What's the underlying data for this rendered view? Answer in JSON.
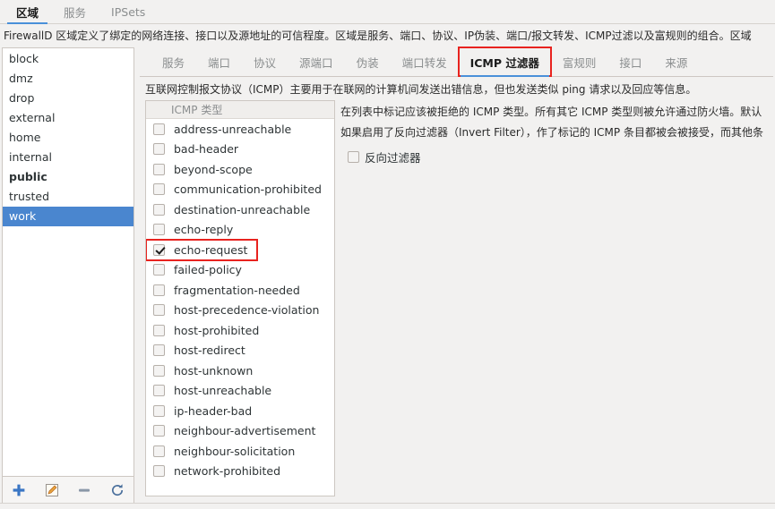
{
  "top_tabs": [
    {
      "label": "区域",
      "active": true
    },
    {
      "label": "服务",
      "active": false
    },
    {
      "label": "IPSets",
      "active": false
    }
  ],
  "zone_description": "FirewallD 区域定义了绑定的网络连接、接口以及源地址的可信程度。区域是服务、端口、协议、IP伪装、端口/报文转发、ICMP过滤以及富规则的组合。区域",
  "zones": [
    {
      "name": "block",
      "default": false,
      "selected": false
    },
    {
      "name": "dmz",
      "default": false,
      "selected": false
    },
    {
      "name": "drop",
      "default": false,
      "selected": false
    },
    {
      "name": "external",
      "default": false,
      "selected": false
    },
    {
      "name": "home",
      "default": false,
      "selected": false
    },
    {
      "name": "internal",
      "default": false,
      "selected": false
    },
    {
      "name": "public",
      "default": true,
      "selected": false
    },
    {
      "name": "trusted",
      "default": false,
      "selected": false
    },
    {
      "name": "work",
      "default": false,
      "selected": true
    }
  ],
  "zone_toolbar": [
    {
      "icon": "add-icon",
      "title": "添加"
    },
    {
      "icon": "edit-icon",
      "title": "编辑"
    },
    {
      "icon": "remove-icon",
      "title": "删除"
    },
    {
      "icon": "reload-icon",
      "title": "重新载入"
    }
  ],
  "inner_tabs": [
    {
      "label": "服务",
      "active": false,
      "marked": false
    },
    {
      "label": "端口",
      "active": false,
      "marked": false
    },
    {
      "label": "协议",
      "active": false,
      "marked": false
    },
    {
      "label": "源端口",
      "active": false,
      "marked": false
    },
    {
      "label": "伪装",
      "active": false,
      "marked": false
    },
    {
      "label": "端口转发",
      "active": false,
      "marked": false
    },
    {
      "label": "ICMP 过滤器",
      "active": true,
      "marked": true
    },
    {
      "label": "富规则",
      "active": false,
      "marked": false
    },
    {
      "label": "接口",
      "active": false,
      "marked": false
    },
    {
      "label": "来源",
      "active": false,
      "marked": false
    }
  ],
  "icmp_description": "互联网控制报文协议（ICMP）主要用于在联网的计算机间发送出错信息，但也发送类似 ping 请求以及回应等信息。",
  "icmp_list": {
    "header": "ICMP 类型",
    "rows": [
      {
        "label": "address-unreachable",
        "checked": false,
        "marked": false
      },
      {
        "label": "bad-header",
        "checked": false,
        "marked": false
      },
      {
        "label": "beyond-scope",
        "checked": false,
        "marked": false
      },
      {
        "label": "communication-prohibited",
        "checked": false,
        "marked": false
      },
      {
        "label": "destination-unreachable",
        "checked": false,
        "marked": false
      },
      {
        "label": "echo-reply",
        "checked": false,
        "marked": false
      },
      {
        "label": "echo-request",
        "checked": true,
        "marked": true
      },
      {
        "label": "failed-policy",
        "checked": false,
        "marked": false
      },
      {
        "label": "fragmentation-needed",
        "checked": false,
        "marked": false
      },
      {
        "label": "host-precedence-violation",
        "checked": false,
        "marked": false
      },
      {
        "label": "host-prohibited",
        "checked": false,
        "marked": false
      },
      {
        "label": "host-redirect",
        "checked": false,
        "marked": false
      },
      {
        "label": "host-unknown",
        "checked": false,
        "marked": false
      },
      {
        "label": "host-unreachable",
        "checked": false,
        "marked": false
      },
      {
        "label": "ip-header-bad",
        "checked": false,
        "marked": false
      },
      {
        "label": "neighbour-advertisement",
        "checked": false,
        "marked": false
      },
      {
        "label": "neighbour-solicitation",
        "checked": false,
        "marked": false
      },
      {
        "label": "network-prohibited",
        "checked": false,
        "marked": false
      }
    ]
  },
  "icmp_side": {
    "line1": "在列表中标记应该被拒绝的 ICMP 类型。所有其它 ICMP 类型则被允许通过防火墙。默认",
    "line2": "如果启用了反向过滤器（Invert Filter），作了标记的 ICMP 条目都被会被接受，而其他条",
    "invert_label": "反向过滤器",
    "invert_checked": false
  },
  "colors": {
    "accent": "#4a90d9",
    "selection": "#4a86cf",
    "annotation": "#e8231f",
    "window_bg": "#f2f1f0",
    "panel_bg": "#ffffff",
    "border": "#cdc7c2"
  }
}
